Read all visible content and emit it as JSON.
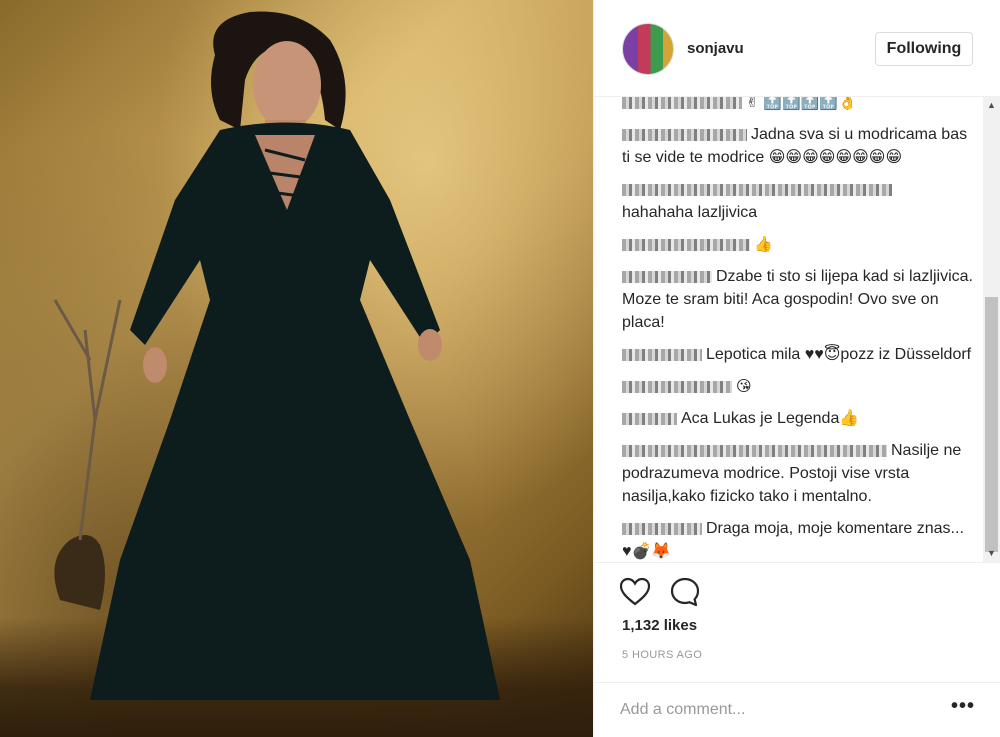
{
  "post": {
    "username": "sonjavu",
    "follow_label": "Following",
    "likes": "1,132 likes",
    "time": "5 HOURS AGO",
    "add_comment_placeholder": "Add a comment...",
    "more_label": "•••"
  },
  "comments": [
    {
      "text": "",
      "emoji": "✌ 🔝🔝🔝🔝👌"
    },
    {
      "text": "Jadna sva si u modricama bas ti se vide te modrice 😁😁😁😁😁😁😁😁",
      "emoji": ""
    },
    {
      "text": "hahahaha lazljivica",
      "emoji": ""
    },
    {
      "text": "",
      "emoji": "👍"
    },
    {
      "text": "Dzabe ti sto si lijepa kad si lazljivica. Moze te sram biti! Aca gospodin! Ovo sve on placa!",
      "emoji": ""
    },
    {
      "text": "Lepotica mila ♥♥😇pozz iz Düsseldorf",
      "emoji": ""
    },
    {
      "text": "",
      "emoji": "😘"
    },
    {
      "text": "Aca Lukas je Legenda👍",
      "emoji": ""
    },
    {
      "text": "Nasilje ne podrazumeva modrice. Postoji vise vrsta nasilja,kako fizicko tako i mentalno.",
      "emoji": ""
    },
    {
      "text": "Draga moja, moje komentare znas... ♥💣🦊",
      "emoji": ""
    }
  ],
  "colors": {
    "text": "#262626",
    "muted": "#999999",
    "border": "#efefef"
  }
}
